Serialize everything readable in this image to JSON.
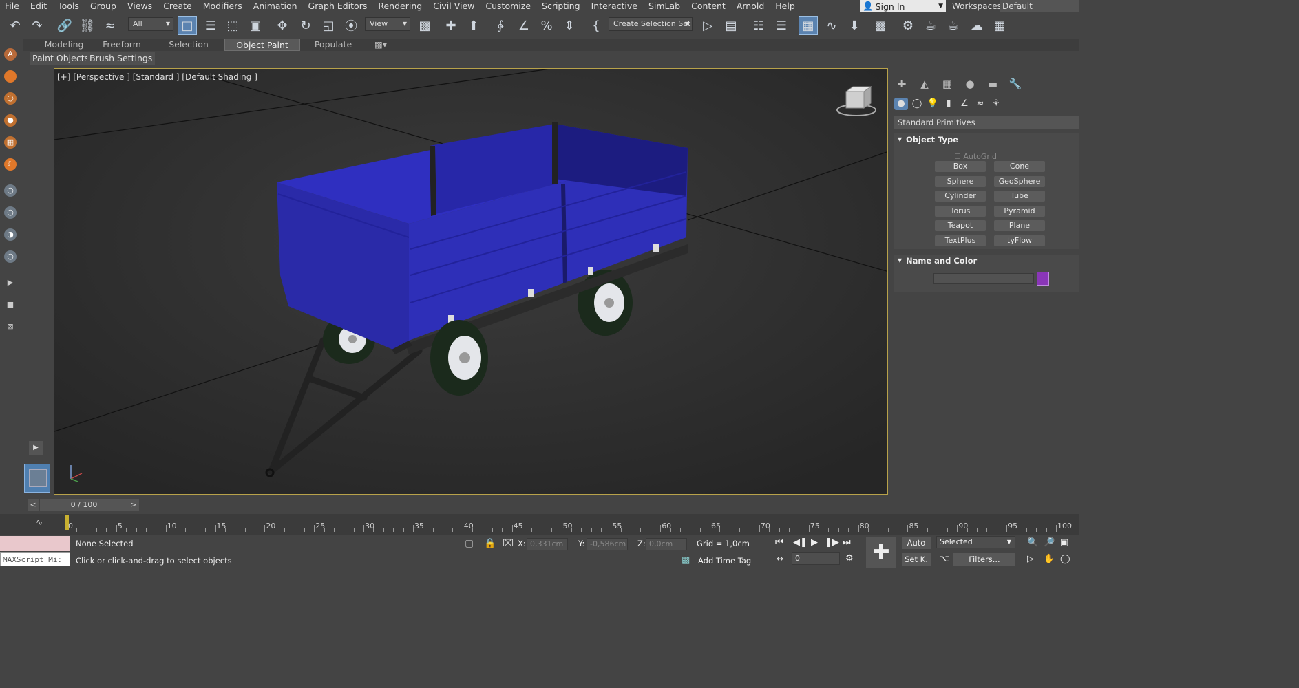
{
  "menubar": {
    "items": [
      "File",
      "Edit",
      "Tools",
      "Group",
      "Views",
      "Create",
      "Modifiers",
      "Animation",
      "Graph Editors",
      "Rendering",
      "Civil View",
      "Customize",
      "Scripting",
      "Interactive",
      "SimLab",
      "Content",
      "Arnold",
      "Help"
    ],
    "sign_in": "Sign In",
    "workspaces_label": "Workspaces:",
    "workspaces_value": "Default"
  },
  "toolbar": {
    "filter_value": "All",
    "refcoord_value": "View",
    "selection_set_value": "Create Selection Set"
  },
  "ribbon": {
    "tabs": [
      "Modeling",
      "Freeform",
      "Selection",
      "Object Paint",
      "Populate"
    ],
    "selected_tab": "Object Paint",
    "subtabs": [
      "Paint Objects",
      "Brush Settings"
    ]
  },
  "viewport": {
    "label": "[+] [Perspective ] [Standard ] [Default Shading ]"
  },
  "command_panel": {
    "category": "Standard Primitives",
    "object_type": {
      "title": "Object Type",
      "autogrid": "AutoGrid",
      "buttons": [
        "Box",
        "Cone",
        "Sphere",
        "GeoSphere",
        "Cylinder",
        "Tube",
        "Torus",
        "Pyramid",
        "Teapot",
        "Plane",
        "TextPlus",
        "tyFlow"
      ]
    },
    "name_color": {
      "title": "Name and Color",
      "color": "#8a36b8"
    }
  },
  "timeline": {
    "frame": "0 / 100",
    "ticks": [
      "0",
      "5",
      "10",
      "15",
      "20",
      "25",
      "30",
      "35",
      "40",
      "45",
      "50",
      "55",
      "60",
      "65",
      "70",
      "75",
      "80",
      "85",
      "90",
      "95",
      "100"
    ]
  },
  "status": {
    "maxscript_placeholder": "MAXScript Mi:",
    "selection": "None Selected",
    "prompt": "Click or click-and-drag to select objects",
    "x_label": "X:",
    "x_value": "0,331cm",
    "y_label": "Y:",
    "y_value": "-0,586cm",
    "z_label": "Z:",
    "z_value": "0,0cm",
    "grid": "Grid = 1,0cm",
    "add_time_tag": "Add Time Tag",
    "auto_key": "Auto",
    "set_key": "Set K.",
    "key_filter": "Selected",
    "filters": "Filters...",
    "frame_spinner": "0"
  }
}
